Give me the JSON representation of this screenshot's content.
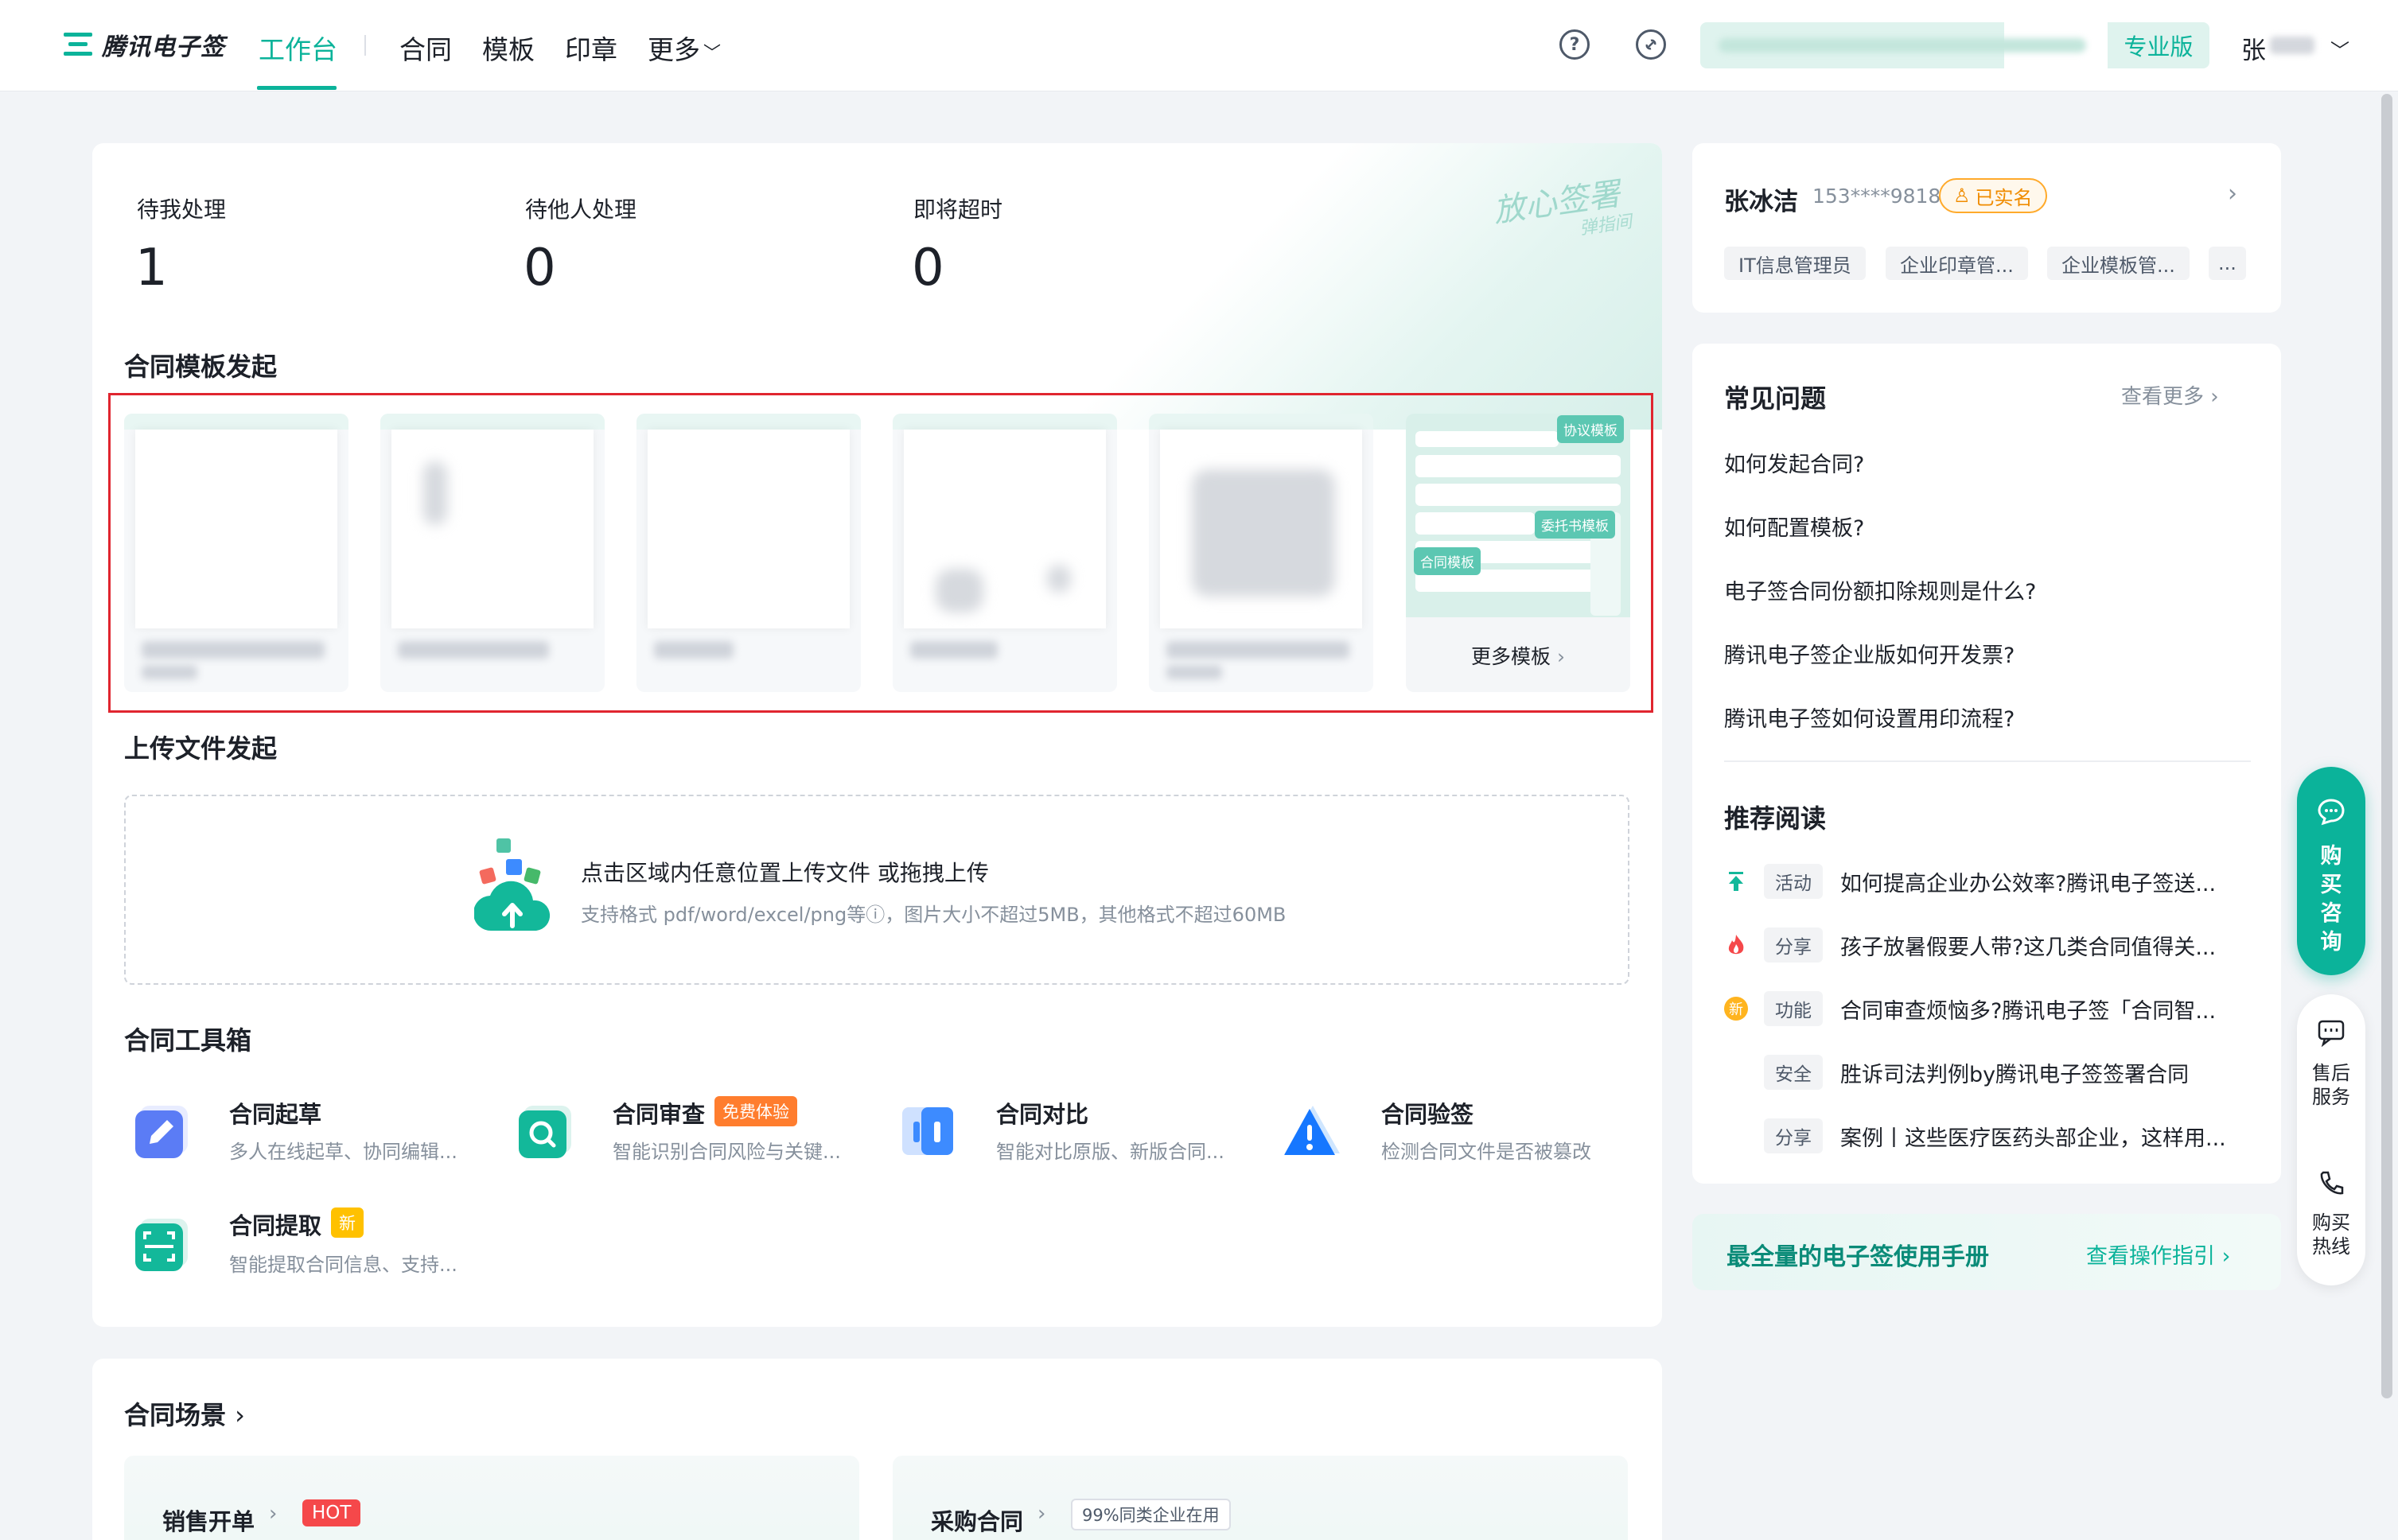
{
  "brand": {
    "name": "腾讯电子签"
  },
  "nav": {
    "items": [
      "工作台",
      "合同",
      "模板",
      "印章",
      "更多"
    ],
    "edition": "专业版",
    "user_initial": "张"
  },
  "stats": [
    {
      "label": "待我处理",
      "value": "1"
    },
    {
      "label": "待他人处理",
      "value": "0"
    },
    {
      "label": "即将超时",
      "value": "0"
    }
  ],
  "slogan": {
    "main": "放心签署",
    "sub": "弹指间"
  },
  "templates": {
    "title": "合同模板发起",
    "more_label": "更多模板",
    "more_tags": [
      "协议模板",
      "委托书模板",
      "合同模板"
    ]
  },
  "upload": {
    "title": "上传文件发起",
    "main": "点击区域内任意位置上传文件 或拖拽上传",
    "sub": "支持格式 pdf/word/excel/png等ⓘ，图片大小不超过5MB，其他格式不超过60MB"
  },
  "toolbox": {
    "title": "合同工具箱",
    "tools": [
      {
        "name": "合同起草",
        "desc": "多人在线起草、协同编辑...",
        "badge": ""
      },
      {
        "name": "合同审查",
        "desc": "智能识别合同风险与关键...",
        "badge": "免费体验"
      },
      {
        "name": "合同对比",
        "desc": "智能对比原版、新版合同...",
        "badge": ""
      },
      {
        "name": "合同验签",
        "desc": "检测合同文件是否被篡改",
        "badge": ""
      },
      {
        "name": "合同提取",
        "desc": "智能提取合同信息、支持...",
        "badge": "新"
      }
    ]
  },
  "scenes": {
    "title": "合同场景",
    "items": [
      {
        "name": "销售开单",
        "badge": "HOT"
      },
      {
        "name": "采购合同",
        "badge": "99%同类企业在用"
      }
    ]
  },
  "user": {
    "name": "张冰洁",
    "phone": "153****9818",
    "verified": "已实名",
    "roles": [
      "IT信息管理员",
      "企业印章管...",
      "企业模板管...",
      "..."
    ]
  },
  "faq": {
    "title": "常见问题",
    "see_more": "查看更多",
    "items": [
      "如何发起合同?",
      "如何配置模板?",
      "电子签合同份额扣除规则是什么?",
      "腾讯电子签企业版如何开发票?",
      "腾讯电子签如何设置用印流程?"
    ]
  },
  "reading": {
    "title": "推荐阅读",
    "items": [
      {
        "tag": "活动",
        "icon": "arrow-up-icon",
        "text": "如何提高企业办公效率?腾讯电子签送..."
      },
      {
        "tag": "分享",
        "icon": "fire-icon",
        "text": "孩子放暑假要人带?这几类合同值得关..."
      },
      {
        "tag": "功能",
        "icon": "new-icon",
        "icon_text": "新",
        "text": "合同审查烦恼多?腾讯电子签「合同智..."
      },
      {
        "tag": "安全",
        "icon": "",
        "text": "胜诉司法判例by腾讯电子签签署合同"
      },
      {
        "tag": "分享",
        "icon": "",
        "text": "案例丨这些医疗医药头部企业，这样用..."
      }
    ]
  },
  "manual": {
    "title": "最全量的电子签使用手册",
    "link": "查看操作指引"
  },
  "float": {
    "buy_consult": [
      "购",
      "买",
      "咨",
      "询"
    ],
    "after_sale": [
      "售后",
      "服务"
    ],
    "hotline": [
      "购买",
      "热线"
    ]
  },
  "colors": {
    "accent": "#0bb39a",
    "highlight_border": "#e0252f"
  }
}
